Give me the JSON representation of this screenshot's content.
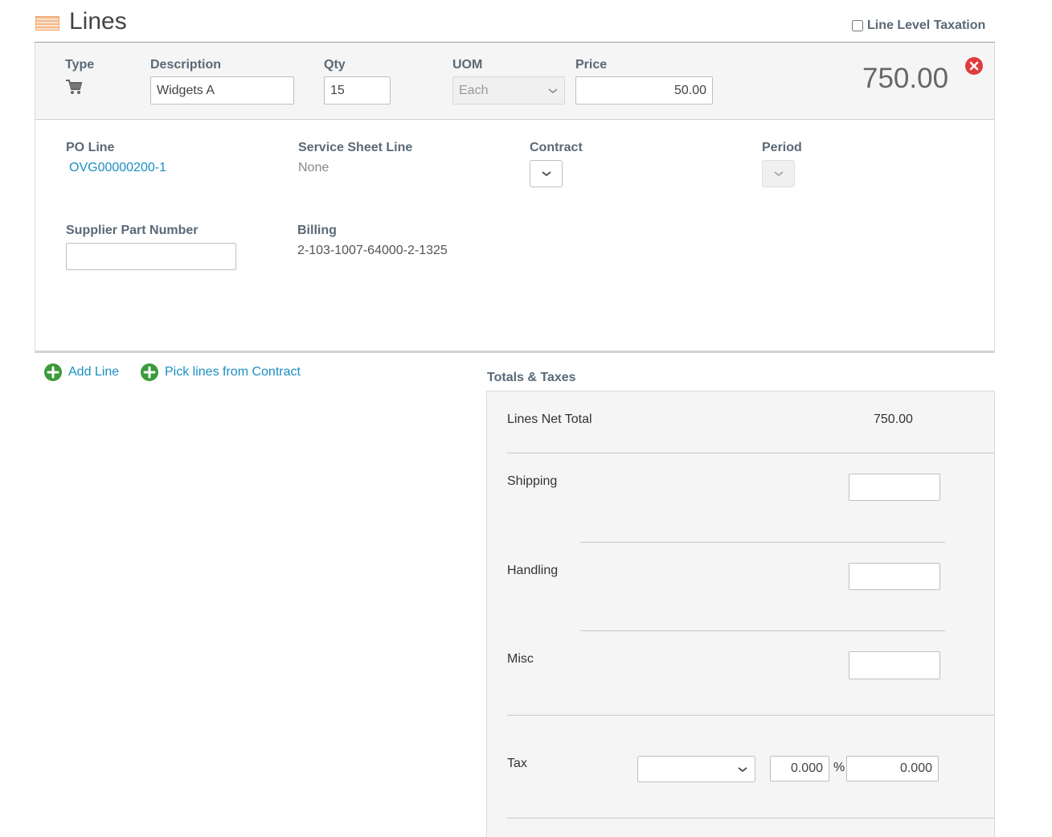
{
  "section": {
    "title": "Lines",
    "line_level_taxation_label": "Line Level Taxation",
    "line_level_taxation_checked": false
  },
  "line": {
    "type_label": "Type",
    "type_icon": "shopping-cart-icon",
    "description_label": "Description",
    "description_value": "Widgets A",
    "qty_label": "Qty",
    "qty_value": "15",
    "uom_label": "UOM",
    "uom_value": "Each",
    "price_label": "Price",
    "price_value": "50.00",
    "total": "750.00"
  },
  "details": {
    "po_line_label": "PO Line",
    "po_line_value": "OVG00000200-1",
    "service_sheet_label": "Service Sheet Line",
    "service_sheet_value": "None",
    "contract_label": "Contract",
    "period_label": "Period",
    "supplier_part_label": "Supplier Part Number",
    "supplier_part_value": "",
    "billing_label": "Billing",
    "billing_value": "2-103-1007-64000-2-1325"
  },
  "actions": {
    "add_line": "Add Line",
    "pick_lines": "Pick lines from Contract"
  },
  "totals": {
    "title": "Totals & Taxes",
    "lines_net_label": "Lines Net Total",
    "lines_net_value": "750.00",
    "shipping_label": "Shipping",
    "handling_label": "Handling",
    "misc_label": "Misc",
    "tax_label": "Tax",
    "tax_rate": "0.000",
    "tax_pct_symbol": "%",
    "tax_amount": "0.000"
  },
  "colors": {
    "label": "#5a6977",
    "link": "#1a8fc1",
    "add": "#3c9a3c",
    "delete": "#e03b3b"
  }
}
